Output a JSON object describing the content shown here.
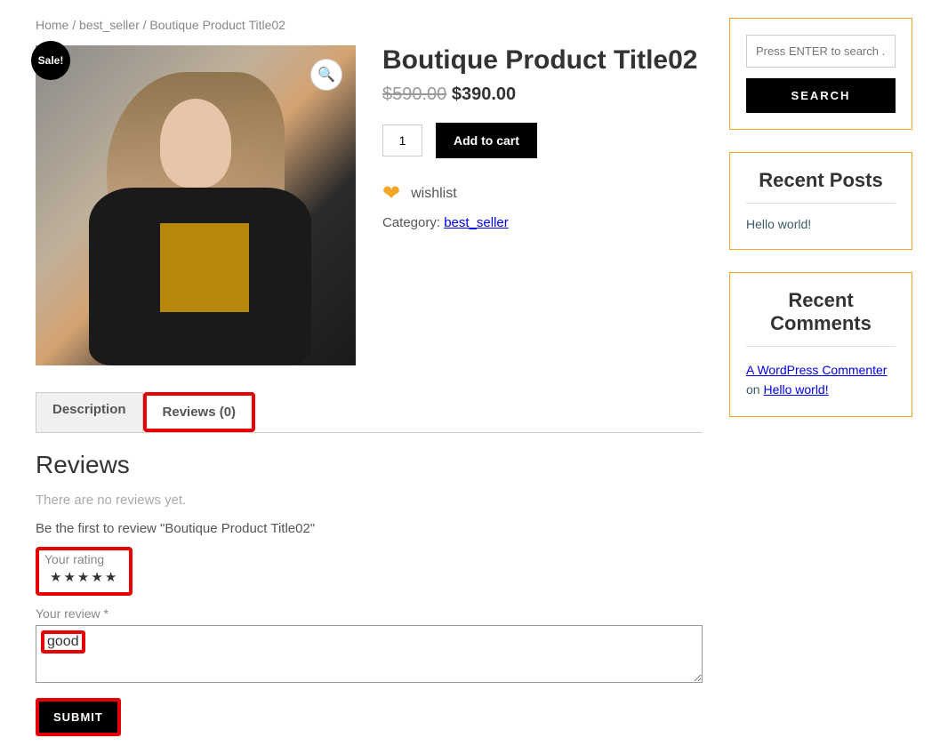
{
  "breadcrumb": {
    "home": "Home",
    "sep1": " / ",
    "cat": "best_seller",
    "sep2": " / ",
    "current": "Boutique Product Title02"
  },
  "product": {
    "sale_badge": "Sale!",
    "title": "Boutique Product Title02",
    "currency": "$",
    "old_price": "590.00",
    "new_price": "390.00",
    "qty_value": "1",
    "add_to_cart": "Add to cart",
    "wishlist": "wishlist",
    "category_label": "Category: ",
    "category": "best_seller"
  },
  "tabs": {
    "description": "Description",
    "reviews": "Reviews (0)"
  },
  "reviews": {
    "heading": "Reviews",
    "none": "There are no reviews yet.",
    "be_first": "Be the first to review \"Boutique Product Title02\"",
    "rating_label": "Your rating",
    "review_label": "Your review *",
    "review_text": "good",
    "submit": "SUBMIT"
  },
  "sidebar": {
    "search_placeholder": "Press ENTER to search .",
    "search_btn": "SEARCH",
    "recent_posts_title": "Recent Posts",
    "recent_post_1": "Hello world!",
    "recent_comments_title": "Recent Comments",
    "comment_author": "A WordPress Commenter",
    "comment_on": " on ",
    "comment_post": "Hello world!"
  }
}
